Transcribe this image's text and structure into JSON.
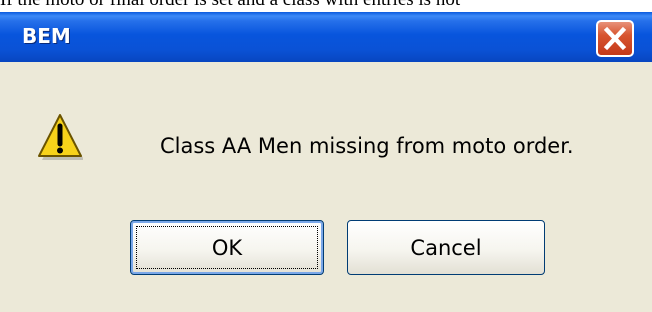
{
  "page": {
    "background_text": "If the moto or final order is set and a class with entries is not"
  },
  "dialog": {
    "title": "BEM",
    "message": "Class AA Men missing from moto order.",
    "icon": "warning-icon",
    "buttons": {
      "ok_label": "OK",
      "cancel_label": "Cancel"
    }
  },
  "colors": {
    "titlebar": "#0a52d6",
    "dialog_bg": "#ece9d8",
    "close_button": "#d7552f",
    "warning_yellow": "#f7d21a"
  }
}
